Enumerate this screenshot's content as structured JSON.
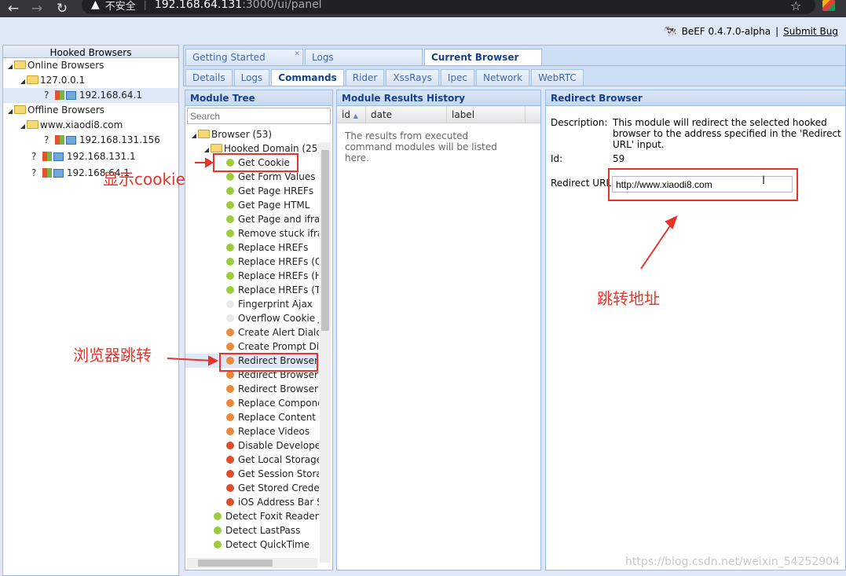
{
  "browser": {
    "security_label": "不安全",
    "url_host": "192.168.64.131",
    "url_path": ":3000/ui/panel"
  },
  "beef": {
    "version": "BeEF  0.4.7.0-alpha",
    "divider": "|",
    "submit_bug": "Submit  Bug"
  },
  "hooked": {
    "title": "Hooked Browsers",
    "online_label": "Online Browsers",
    "online_host": "127.0.0.1",
    "online_ip": "192.168.64.1",
    "offline_label": "Offline Browsers",
    "offline_domain": "www.xiaodi8.com",
    "offline_ip1": "192.168.131.156",
    "offline_ip2": "192.168.131.1",
    "offline_ip3": "192.168.64.1"
  },
  "tabs": {
    "getting_started": "Getting Started",
    "logs": "Logs",
    "current_browser": "Current Browser"
  },
  "subtabs": {
    "details": "Details",
    "logs": "Logs",
    "commands": "Commands",
    "rider": "Rider",
    "xssrays": "XssRays",
    "ipec": "Ipec",
    "network": "Network",
    "webrtc": "WebRTC"
  },
  "module_tree": {
    "title": "Module Tree",
    "search_placeholder": "Search",
    "browser_folder": "Browser (53)",
    "hooked_domain_folder": "Hooked Domain (25)",
    "modules": [
      {
        "label": "Get Cookie",
        "color": "#9ccc3c"
      },
      {
        "label": "Get Form Values",
        "color": "#9ccc3c"
      },
      {
        "label": "Get Page HREFs",
        "color": "#9ccc3c"
      },
      {
        "label": "Get Page HTML",
        "color": "#9ccc3c"
      },
      {
        "label": "Get Page and ifram",
        "color": "#9ccc3c"
      },
      {
        "label": "Remove stuck ifram",
        "color": "#9ccc3c"
      },
      {
        "label": "Replace HREFs",
        "color": "#9ccc3c"
      },
      {
        "label": "Replace HREFs (C",
        "color": "#9ccc3c"
      },
      {
        "label": "Replace HREFs (H",
        "color": "#9ccc3c"
      },
      {
        "label": "Replace HREFs (TI",
        "color": "#9ccc3c"
      },
      {
        "label": "Fingerprint Ajax",
        "color": "#e8e8e8"
      },
      {
        "label": "Overflow Cookie Ja",
        "color": "#e8e8e8"
      },
      {
        "label": "Create Alert Dialog",
        "color": "#f0883a"
      },
      {
        "label": "Create Prompt Dial",
        "color": "#f0883a"
      },
      {
        "label": "Redirect Browser",
        "color": "#f0883a"
      },
      {
        "label": "Redirect Browser (F",
        "color": "#f0883a"
      },
      {
        "label": "Redirect Browser (i",
        "color": "#f0883a"
      },
      {
        "label": "Replace Componer",
        "color": "#f0883a"
      },
      {
        "label": "Replace Content (D",
        "color": "#f0883a"
      },
      {
        "label": "Replace Videos",
        "color": "#f0883a"
      },
      {
        "label": "Disable Developer '",
        "color": "#e04d2d"
      },
      {
        "label": "Get Local Storage",
        "color": "#e04d2d"
      },
      {
        "label": "Get Session Storag",
        "color": "#e04d2d"
      },
      {
        "label": "Get Stored Credent",
        "color": "#e04d2d"
      },
      {
        "label": "iOS Address Bar Sp",
        "color": "#e04d2d"
      }
    ],
    "top_modules": [
      {
        "label": "Detect Foxit Reader",
        "color": "#9ccc3c"
      },
      {
        "label": "Detect LastPass",
        "color": "#9ccc3c"
      },
      {
        "label": "Detect QuickTime",
        "color": "#9ccc3c"
      }
    ]
  },
  "results": {
    "title": "Module Results History",
    "col_id": "id",
    "col_date": "date",
    "col_label": "label",
    "empty_text": "The results from executed command modules will be listed here."
  },
  "redirect": {
    "title": "Redirect Browser",
    "description_label": "Description:",
    "description_text": "This module will redirect the selected hooked browser to the address specified in the 'Redirect URL' input.",
    "id_label": "Id:",
    "id_value": "59",
    "url_label": "Redirect URL:",
    "url_value": "http://www.xiaodi8.com"
  },
  "annotations": {
    "show_cookie": "显示cookie",
    "browser_redirect": "浏览器跳转",
    "redirect_address": "跳转地址"
  },
  "watermark": "https://blog.csdn.net/weixin_54252904"
}
